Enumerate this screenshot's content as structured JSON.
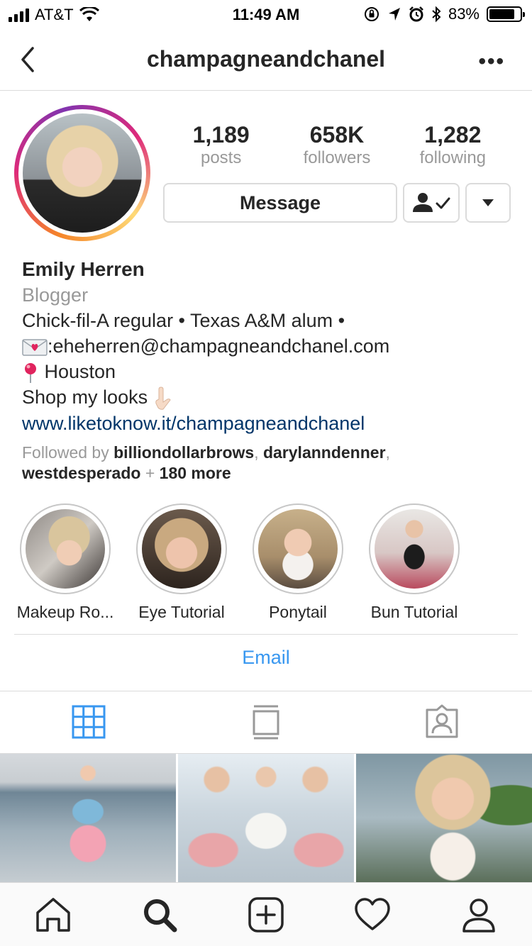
{
  "status_bar": {
    "carrier": "AT&T",
    "time": "11:49 AM",
    "battery_percent": "83%",
    "battery_level": 0.83,
    "icons": [
      "signal-icon",
      "wifi-icon",
      "orientation-lock-icon",
      "location-icon",
      "alarm-icon",
      "bluetooth-icon",
      "battery-icon"
    ]
  },
  "nav": {
    "title": "champagneandchanel",
    "back_icon": "chevron-left-icon",
    "more_label": "•••"
  },
  "profile": {
    "stats": [
      {
        "value": "1,189",
        "label": "posts"
      },
      {
        "value": "658K",
        "label": "followers"
      },
      {
        "value": "1,282",
        "label": "following"
      }
    ],
    "message_label": "Message",
    "name": "Emily Herren",
    "category": "Blogger",
    "bio_lines": [
      "Chick-fil-A regular • Texas A&M alum •",
      ":eheherren@champagneandchanel.com",
      " Houston",
      "Shop my looks "
    ],
    "link": "www.liketoknow.it/champagneandchanel",
    "followed_by": {
      "prefix": "Followed by ",
      "user1": "billiondollarbrows",
      "sep1": ", ",
      "user2": "darylanndenner",
      "sep2": ",",
      "user3": "westdesperado",
      "sep3": " + ",
      "more": "180 more"
    }
  },
  "highlights": [
    {
      "label": "Makeup Ro..."
    },
    {
      "label": "Eye Tutorial"
    },
    {
      "label": "Ponytail"
    },
    {
      "label": "Bun Tutorial"
    }
  ],
  "email_label": "Email",
  "tabs": [
    "grid-icon",
    "feed-icon",
    "tagged-icon"
  ],
  "bottom_nav": [
    "home-icon",
    "search-icon",
    "add-icon",
    "heart-icon",
    "profile-icon"
  ],
  "colors": {
    "link_blue": "#3897f0",
    "bio_link": "#003569",
    "text": "#262626",
    "muted": "#999999",
    "border": "#dbdbdb"
  }
}
